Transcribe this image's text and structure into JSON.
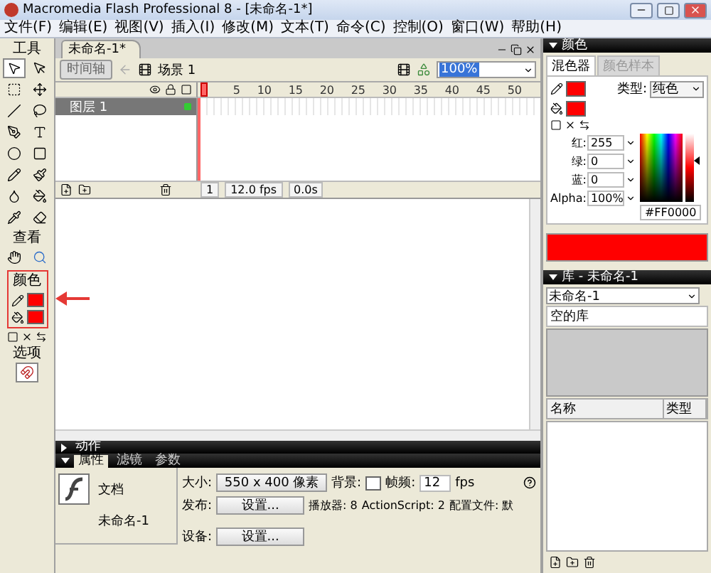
{
  "window": {
    "title": "Macromedia Flash Professional 8 - [未命名-1*]"
  },
  "menu": [
    "文件(F)",
    "编辑(E)",
    "视图(V)",
    "插入(I)",
    "修改(M)",
    "文本(T)",
    "命令(C)",
    "控制(O)",
    "窗口(W)",
    "帮助(H)"
  ],
  "toolbox": {
    "title": "工具",
    "view_label": "查看",
    "color_label": "颜色",
    "color_highlighted": true,
    "options_label": "选项"
  },
  "document": {
    "tab": "未命名-1*",
    "timeline_button": "时间轴",
    "scene": "场景 1",
    "zoom": "100%"
  },
  "timeline": {
    "ruler": [
      "5",
      "10",
      "15",
      "20",
      "25",
      "30",
      "35",
      "40",
      "45",
      "50"
    ],
    "layers": [
      {
        "name": "图层 1",
        "selected": true
      }
    ],
    "current_frame": "1",
    "fps": "12.0 fps",
    "time": "0.0s"
  },
  "actions_panel": {
    "title": "动作",
    "expanded": false
  },
  "properties": {
    "tabs": [
      {
        "label": "属性",
        "selected": true
      },
      {
        "label": "滤镜",
        "selected": false
      },
      {
        "label": "参数",
        "selected": false
      }
    ],
    "doc_label": "文档",
    "doc_name": "未命名-1",
    "size_label": "大小:",
    "size_button": "550 x 400 像素",
    "background_label": "背景:",
    "fps_label": "帧频:",
    "fps": "12",
    "fps_unit": "fps",
    "publish_label": "发布:",
    "publish_button": "设置...",
    "player": "播放器: 8",
    "actionscript": "ActionScript: 2",
    "profile": "配置文件: 默",
    "device_label": "设备:",
    "device_button": "设置..."
  },
  "color_panel": {
    "title": "颜色",
    "tabs": [
      {
        "label": "混色器",
        "selected": true
      },
      {
        "label": "颜色样本",
        "selected": false
      }
    ],
    "type_label": "类型:",
    "type": "纯色",
    "channels": [
      {
        "label": "红:",
        "value": "255"
      },
      {
        "label": "绿:",
        "value": "0"
      },
      {
        "label": "蓝:",
        "value": "0"
      }
    ],
    "alpha_label": "Alpha:",
    "alpha": "100%",
    "hex": "#FF0000",
    "brightness_slider": {
      "level": 0.6
    }
  },
  "library_panel": {
    "title": "库 - 未命名-1",
    "document": "未命名-1",
    "status": "空的库",
    "columns": [
      "名称",
      "类型"
    ]
  }
}
